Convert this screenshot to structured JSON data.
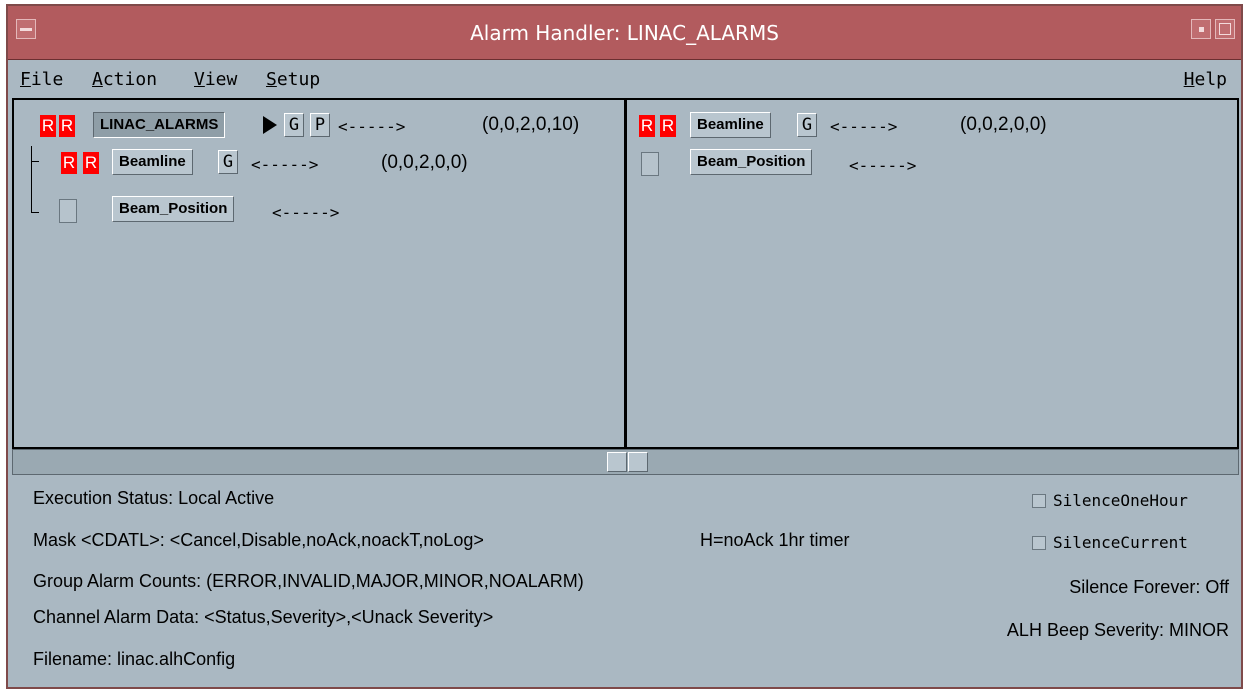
{
  "window": {
    "title": "Alarm Handler: LINAC_ALARMS"
  },
  "menubar": {
    "file": {
      "u": "F",
      "rest": "ile"
    },
    "action": {
      "u": "A",
      "rest": "ction"
    },
    "view": {
      "u": "V",
      "rest": "iew"
    },
    "setup": {
      "u": "S",
      "rest": "etup"
    },
    "help": {
      "u": "H",
      "rest": "elp"
    }
  },
  "tree": {
    "root": {
      "r1": "R",
      "r2": "R",
      "name": "LINAC_ALARMS",
      "g": "G",
      "p": "P",
      "arrow": "<----->",
      "counts": "(0,0,2,0,10)"
    },
    "beamline": {
      "r1": "R",
      "r2": "R",
      "name": "Beamline",
      "g": "G",
      "arrow": "<----->",
      "counts": "(0,0,2,0,0)"
    },
    "beam_position": {
      "name": "Beam_Position",
      "arrow": "<----->"
    }
  },
  "detail": {
    "beamline": {
      "r1": "R",
      "r2": "R",
      "name": "Beamline",
      "g": "G",
      "arrow": "<----->",
      "counts": "(0,0,2,0,0)"
    },
    "beam_position": {
      "name": "Beam_Position",
      "arrow": "<----->"
    }
  },
  "status": {
    "execution": "Execution Status:  Local Active",
    "mask": "Mask <CDATL>:  <Cancel,Disable,noAck,noackT,noLog>",
    "mask_note": "H=noAck 1hr timer",
    "group_counts": "Group Alarm Counts:  (ERROR,INVALID,MAJOR,MINOR,NOALARM)",
    "channel_data": "Channel Alarm Data:  <Status,Severity>,<Unack Severity>",
    "filename": "Filename:   linac.alhConfig",
    "silence_one_hour": "SilenceOneHour",
    "silence_current": "SilenceCurrent",
    "silence_forever": "Silence Forever:  Off",
    "beep_severity": "ALH Beep Severity:  MINOR"
  },
  "colors": {
    "title_bar": "#b25b5e",
    "background": "#aab8c2",
    "alarm_red": "#ff0000"
  }
}
